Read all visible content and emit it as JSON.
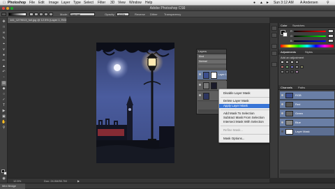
{
  "menubar": {
    "apple": "",
    "items": [
      "Photoshop",
      "File",
      "Edit",
      "Image",
      "Layer",
      "Type",
      "Select",
      "Filter",
      "3D",
      "View",
      "Window",
      "Help"
    ],
    "time": "Sun 3:12 AM",
    "user": "A Andersen"
  },
  "window": {
    "title": "Adobe Photoshop CS6"
  },
  "options": {
    "mode_label": "Mode:",
    "mode_value": "Normal",
    "opacity_label": "Opacity:",
    "opacity_value": "100%",
    "reverse": "Reverse",
    "dither": "Dither",
    "transparency": "Transparency"
  },
  "document": {
    "tab": "141_1279013_full.jpg @ 12.5% (Layer 1, RGB/8)",
    "zoom": "12.5%",
    "doc_size": "Doc: 24.0M/50.7M"
  },
  "layers_panel": {
    "title": "Layers",
    "kind_label": "Kind",
    "mode": "Normal",
    "layer_name": "Layer 1"
  },
  "context_menu": {
    "items": [
      {
        "label": "Disable Layer Mask",
        "state": "normal"
      },
      {
        "label": "Delete Layer Mask",
        "state": "normal"
      },
      {
        "label": "Apply Layer Mask",
        "state": "highlighted"
      },
      {
        "label": "Add Mask To Selection",
        "state": "normal"
      },
      {
        "label": "Subtract Mask From Selection",
        "state": "normal"
      },
      {
        "label": "Intersect Mask With Selection",
        "state": "normal"
      },
      {
        "label": "Refine Mask...",
        "state": "disabled"
      },
      {
        "label": "Mask Options...",
        "state": "normal"
      }
    ]
  },
  "right_panel": {
    "top_tabs": [
      "Color",
      "Swatches"
    ],
    "channels": [
      "R",
      "G",
      "B"
    ],
    "adjustments_tabs": [
      "Adjustments",
      "Styles"
    ],
    "add_adjustment": "Add an adjustment",
    "bottom_tabs": [
      "Channels",
      "Paths"
    ],
    "channel_rows": [
      "RGB",
      "Red",
      "Green",
      "Blue",
      "Layer Mask"
    ]
  },
  "minibridge": {
    "tab": "Mini Bridge"
  },
  "colors": {
    "highlight": "#3875d7",
    "sky": "#3c4f8e",
    "panel": "#3f3f3f",
    "selected_row": "#6a7fa6"
  }
}
